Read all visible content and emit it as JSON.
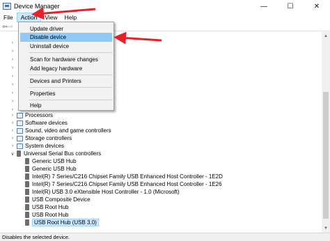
{
  "window": {
    "title": "Device Manager",
    "controls": {
      "minimize": "—",
      "maximize": "☐",
      "close": "✕"
    }
  },
  "menubar": [
    "File",
    "Action",
    "View",
    "Help"
  ],
  "toolbar": {
    "back_icon": "⇦",
    "forward_icon": "⇨"
  },
  "action_menu": {
    "items": [
      {
        "label": "Update driver"
      },
      {
        "label": "Disable device",
        "highlighted": true
      },
      {
        "label": "Uninstall device"
      },
      {
        "label": "Scan for hardware changes"
      },
      {
        "label": "Add legacy hardware"
      },
      {
        "label": "Devices and Printers"
      },
      {
        "label": "Properties"
      },
      {
        "label": "Help"
      }
    ]
  },
  "tree": {
    "categories": [
      "Processors",
      "Software devices",
      "Sound, video and game controllers",
      "Storage controllers",
      "System devices",
      "Universal Serial Bus controllers"
    ],
    "usb_children": [
      "Generic USB Hub",
      "Generic USB Hub",
      "Intel(R) 7 Series/C216 Chipset Family USB Enhanced Host Controller - 1E2D",
      "Intel(R) 7 Series/C216 Chipset Family USB Enhanced Host Controller - 1E26",
      "Intel(R) USB 3.0 eXtensible Host Controller - 1.0 (Microsoft)",
      "USB Composite Device",
      "USB Root Hub",
      "USB Root Hub",
      "USB Root Hub (USB 3.0)"
    ],
    "selected": "USB Root Hub (USB 3.0)"
  },
  "status": "Disables the selected device.",
  "colors": {
    "highlight": "#91c9f7",
    "selection": "#cce8ff",
    "arrow": "#e8202a"
  }
}
